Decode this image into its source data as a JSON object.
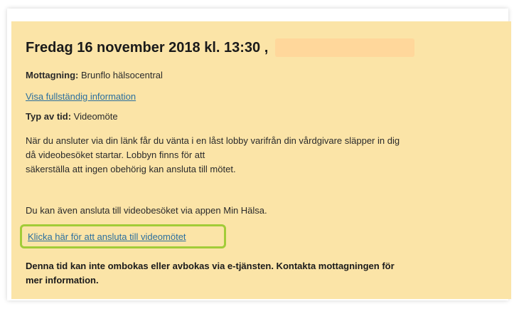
{
  "appointment": {
    "datetime": "Fredag 16 november 2018 kl. 13:30 ,",
    "clinic_label": "Mottagning:",
    "clinic_value": "Brunflo hälsocentral",
    "info_link": "Visa fullständig information",
    "type_label": "Typ av tid:",
    "type_value": "Videomöte",
    "description_lines": [
      "När du ansluter via din länk får du vänta i en låst lobby varifrån din vårdgivare släpper in dig",
      "då videobesöket startar. Lobbyn finns för att",
      "säkerställa att ingen obehörig kan ansluta till mötet."
    ],
    "app_note": "Du kan även ansluta till videobesöket via appen Min Hälsa.",
    "join_link": "Klicka här för att ansluta till videomötet",
    "notice_lines": [
      "Denna tid kan inte ombokas eller avbokas via e-tjänsten. Kontakta mottagningen för",
      "mer information."
    ]
  },
  "colors": {
    "card_background": "#fbe4a7",
    "redaction": "#ffd79b",
    "highlight_border": "#a2cc38",
    "link": "#2b6f9e"
  }
}
